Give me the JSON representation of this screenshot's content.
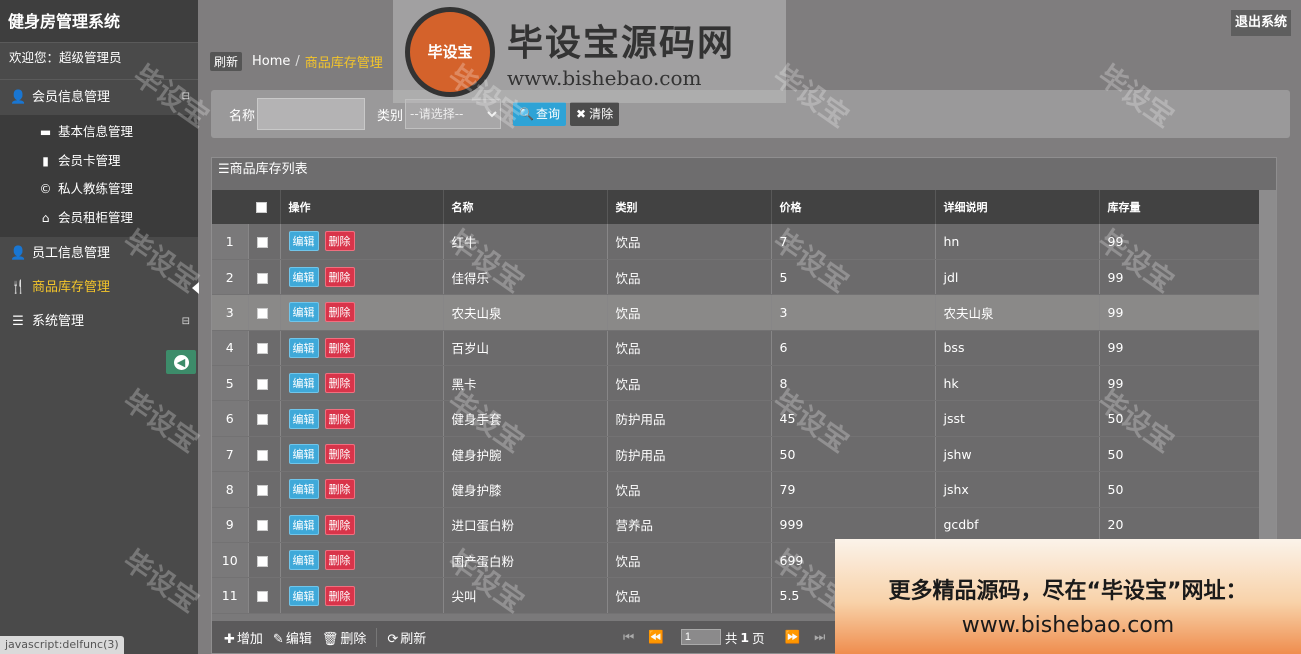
{
  "app": {
    "title": "健身房管理系统",
    "welcome": "欢迎您：超级管理员",
    "logout_label": "退出系统"
  },
  "sidebar": {
    "groups": [
      {
        "label": "会员信息管理",
        "icon": "user-icon",
        "toggle": "⊟",
        "children": [
          {
            "label": "基本信息管理",
            "icon": "folder-icon"
          },
          {
            "label": "会员卡管理",
            "icon": "book-icon"
          },
          {
            "label": "私人教练管理",
            "icon": "copyright-icon"
          },
          {
            "label": "会员租柜管理",
            "icon": "home-icon"
          }
        ]
      },
      {
        "label": "员工信息管理",
        "icon": "user-icon"
      },
      {
        "label": "商品库存管理",
        "icon": "cutlery-icon",
        "active": true
      },
      {
        "label": "系统管理",
        "icon": "list-icon",
        "toggle": "⊟"
      }
    ]
  },
  "breadcrumb": {
    "refresh_label": "刷新",
    "home": "Home",
    "separator": "/",
    "current": "商品库存管理"
  },
  "search": {
    "name_label": "名称",
    "name_value": "",
    "type_label": "类别",
    "type_selected": "--请选择--",
    "query_label": "查询",
    "clear_label": "清除"
  },
  "grid": {
    "title": "商品库存列表",
    "columns": [
      "操作",
      "名称",
      "类别",
      "价格",
      "详细说明",
      "库存量"
    ],
    "edit_label": "编辑",
    "delete_label": "删除",
    "rows": [
      {
        "no": "1",
        "name": "红牛",
        "type": "饮品",
        "price": "7",
        "desc": "hn",
        "stock": "99"
      },
      {
        "no": "2",
        "name": "佳得乐",
        "type": "饮品",
        "price": "5",
        "desc": "jdl",
        "stock": "99"
      },
      {
        "no": "3",
        "name": "农夫山泉",
        "type": "饮品",
        "price": "3",
        "desc": "农夫山泉",
        "stock": "99",
        "selected": true
      },
      {
        "no": "4",
        "name": "百岁山",
        "type": "饮品",
        "price": "6",
        "desc": "bss",
        "stock": "99"
      },
      {
        "no": "5",
        "name": "黑卡",
        "type": "饮品",
        "price": "8",
        "desc": "hk",
        "stock": "99"
      },
      {
        "no": "6",
        "name": "健身手套",
        "type": "防护用品",
        "price": "45",
        "desc": "jsst",
        "stock": "50"
      },
      {
        "no": "7",
        "name": "健身护腕",
        "type": "防护用品",
        "price": "50",
        "desc": "jshw",
        "stock": "50"
      },
      {
        "no": "8",
        "name": "健身护膝",
        "type": "饮品",
        "price": "79",
        "desc": "jshx",
        "stock": "50"
      },
      {
        "no": "9",
        "name": "进口蛋白粉",
        "type": "营养品",
        "price": "999",
        "desc": "gcdbf",
        "stock": "20"
      },
      {
        "no": "10",
        "name": "国产蛋白粉",
        "type": "饮品",
        "price": "699",
        "desc": "",
        "stock": ""
      },
      {
        "no": "11",
        "name": "尖叫",
        "type": "饮品",
        "price": "5.5",
        "desc": "",
        "stock": ""
      }
    ]
  },
  "toolbar": {
    "add_label": "增加",
    "edit_label": "编辑",
    "delete_label": "删除",
    "refresh_label": "刷新"
  },
  "pager": {
    "page_value": "1",
    "total_prefix": "共",
    "total_pages": "1",
    "total_suffix": "页"
  },
  "statusbar": {
    "text": "javascript:delfunc(3)"
  },
  "watermark": {
    "text": "毕设宝",
    "logo_badge": "毕设宝",
    "logo_title": "毕设宝源码网",
    "logo_url": "www.bishebao.com",
    "promo_line1": "更多精品源码，尽在“毕设宝”网址：",
    "promo_line2": "www.bishebao.com"
  }
}
